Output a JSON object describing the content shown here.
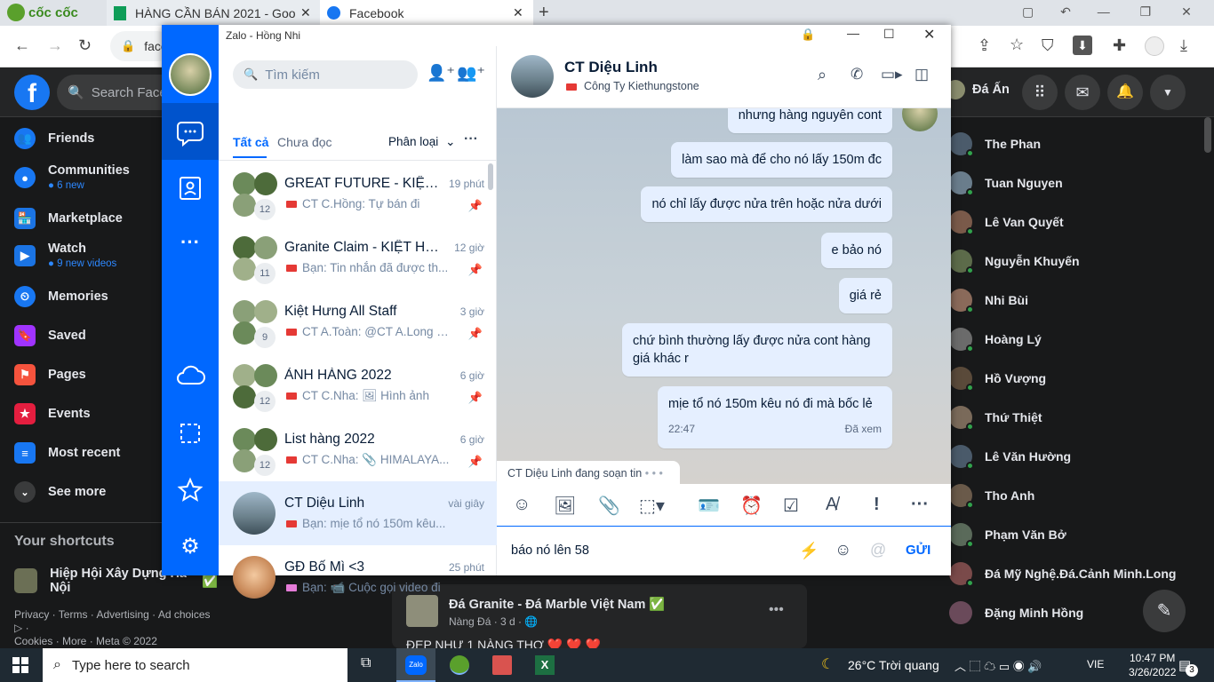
{
  "browser": {
    "brand": "cốc cốc",
    "tabs": [
      {
        "title": "HÀNG CẦN BÁN 2021 - Goo"
      },
      {
        "title": "Facebook"
      }
    ],
    "address": "face"
  },
  "facebook": {
    "search_placeholder": "Search Faceb",
    "user_name": "Đá Ấn",
    "left_nav": [
      {
        "label": "Friends",
        "icon": "friends-icon",
        "sub": ""
      },
      {
        "label": "Communities",
        "icon": "communities-icon",
        "sub": "6 new"
      },
      {
        "label": "Marketplace",
        "icon": "marketplace-icon",
        "sub": ""
      },
      {
        "label": "Watch",
        "icon": "watch-icon",
        "sub": "9 new videos"
      },
      {
        "label": "Memories",
        "icon": "memories-icon",
        "sub": ""
      },
      {
        "label": "Saved",
        "icon": "saved-icon",
        "sub": ""
      },
      {
        "label": "Pages",
        "icon": "pages-icon",
        "sub": ""
      },
      {
        "label": "Events",
        "icon": "events-icon",
        "sub": ""
      },
      {
        "label": "Most recent",
        "icon": "most-recent-icon",
        "sub": ""
      },
      {
        "label": "See more",
        "icon": "chevron-down-icon",
        "sub": ""
      }
    ],
    "shortcuts_title": "Your shortcuts",
    "shortcut": "Hiệp Hội Xây Dựng Hà Nội",
    "footer_line1": "Privacy · Terms · Advertising · Ad choices ▷ ·",
    "footer_line2": "Cookies · More · Meta © 2022",
    "contacts": [
      "The Phan",
      "Tuan Nguyen",
      "Lê Van Quyết",
      "Nguyễn Khuyến",
      "Nhi Bùi",
      "Hoàng Lý",
      "Hồ Vượng",
      "Thứ Thiệt",
      "Lê Văn Hường",
      "Tho Anh",
      "Phạm Văn Bở",
      "Đá Mỹ Nghệ.Đá.Cảnh Minh.Long",
      "Đặng Minh Hồng"
    ],
    "post": {
      "page": "Đá Granite - Đá Marble Việt Nam",
      "meta": "Nàng Đá · 3 d ·",
      "text": "ĐẸP NHƯ 1 NÀNG THƠ ❤️ ❤️ ❤️"
    }
  },
  "zalo": {
    "window_title": "Zalo - Hồng Nhi",
    "search_placeholder": "Tìm kiếm",
    "filter_all": "Tất cả",
    "filter_unread": "Chưa đọc",
    "classify": "Phân loại",
    "conversations": [
      {
        "name": "GREAT FUTURE - KIỆT ...",
        "time": "19 phút",
        "msg": "CT C.Hồng: Tự bán đi",
        "count": "12",
        "tag": "red",
        "pinned": true
      },
      {
        "name": "Granite Claim - KIỆT HƯ...",
        "time": "12 giờ",
        "msg": "Bạn: Tin nhắn đã được th...",
        "count": "11",
        "tag": "red",
        "pinned": true
      },
      {
        "name": "Kiệt Hưng All Staff",
        "time": "3 giờ",
        "msg": "CT A.Toàn: @CT A.Long h...",
        "count": "9",
        "tag": "red",
        "pinned": true
      },
      {
        "name": "ẢNH HÀNG 2022",
        "time": "6 giờ",
        "msg": "CT C.Nha: 🖼 Hình ảnh",
        "count": "12",
        "tag": "red",
        "pinned": true
      },
      {
        "name": "List hàng 2022",
        "time": "6 giờ",
        "msg": "CT C.Nha: 📎 HIMALAYA...",
        "count": "12",
        "tag": "red",
        "pinned": true
      },
      {
        "name": "CT Diệu Linh",
        "time": "vài giây",
        "msg": "Bạn: mịe tổ nó 150m kêu...",
        "count": "",
        "tag": "red",
        "pinned": false
      },
      {
        "name": "GĐ Bố Mì <3",
        "time": "25 phút",
        "msg": "Bạn: 📹 Cuộc gọi video đi",
        "count": "",
        "tag": "pink",
        "pinned": false
      }
    ],
    "chat": {
      "contact_name": "CT Diệu Linh",
      "contact_company": "Công Ty Kiethungstone",
      "messages": [
        "nhưng hàng nguyên cont",
        "làm sao mà để cho nó lấy 150m đc",
        "nó chỉ lấy được nửa trên hoặc nửa dưới",
        "e bảo nó",
        "giá rẻ",
        "chứ bình thường lấy được nửa cont hàng giá khác r",
        "mịe tổ nó 150m kêu nó đi mà bốc lẻ"
      ],
      "last_time": "22:47",
      "seen": "Đã xem",
      "typing": "CT Diệu Linh đang soạn tin",
      "input_text": "báo nó lên 58",
      "send_label": "GỬI"
    }
  },
  "taskbar": {
    "search_placeholder": "Type here to search",
    "weather": "26°C  Trời quang",
    "lang": "VIE",
    "time": "10:47 PM",
    "date": "3/26/2022",
    "notif_count": "3"
  },
  "colors": {
    "zalo_blue": "#0068ff",
    "fb_dark": "#18191a",
    "bubble": "#e5efff",
    "online": "#31a24c"
  }
}
